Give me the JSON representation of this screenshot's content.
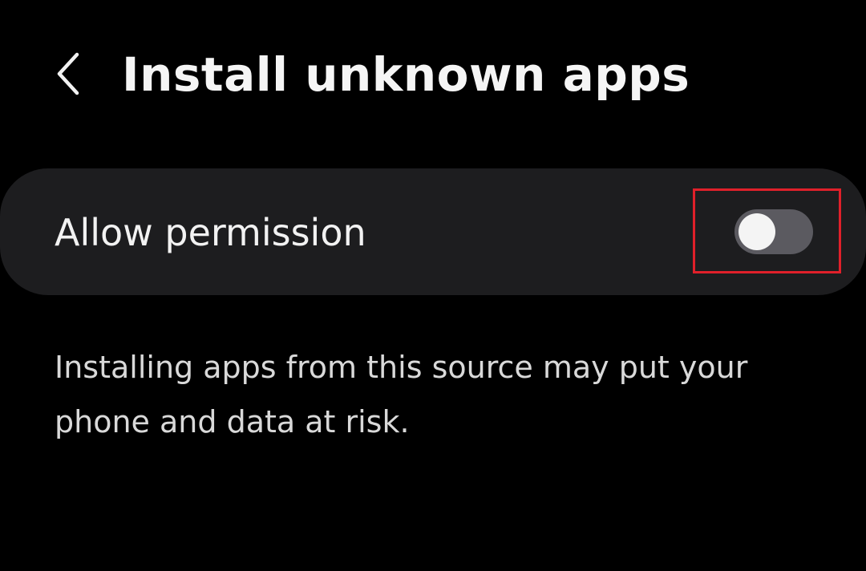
{
  "header": {
    "back_icon": "chevron-left-icon",
    "title": "Install unknown apps"
  },
  "permission": {
    "label": "Allow permission",
    "toggle_state": "off",
    "toggle_track_color": "#5b5a60",
    "highlight_color": "#e0202a"
  },
  "info": {
    "warning_text": "Installing apps from this source may put your phone and data at risk."
  },
  "colors": {
    "background": "#000000",
    "card": "#1d1d1f",
    "text": "#f2f2f2"
  }
}
